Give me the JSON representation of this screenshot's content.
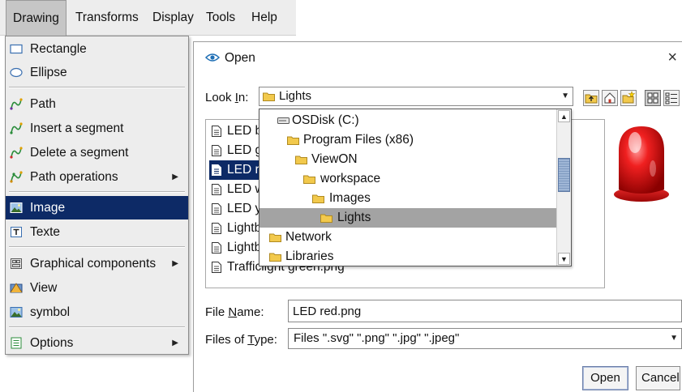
{
  "menubar": {
    "items": [
      {
        "label": "Drawing"
      },
      {
        "label": "Transforms"
      },
      {
        "label": "Display"
      },
      {
        "label": "Tools"
      },
      {
        "label": "Help"
      }
    ]
  },
  "drawing_menu": {
    "items": [
      {
        "label": "Rectangle",
        "icon": "rectangle-icon"
      },
      {
        "label": "Ellipse",
        "icon": "ellipse-icon"
      },
      {
        "label": "Path",
        "icon": "path-icon"
      },
      {
        "label": "Insert a segment",
        "icon": "insert-segment-icon"
      },
      {
        "label": "Delete a segment",
        "icon": "delete-segment-icon"
      },
      {
        "label": "Path operations",
        "icon": "path-operations-icon",
        "submenu": true
      },
      {
        "label": "Image",
        "icon": "image-icon",
        "selected": true
      },
      {
        "label": "Texte",
        "icon": "text-icon"
      },
      {
        "label": "Graphical components",
        "icon": "components-icon",
        "submenu": true
      },
      {
        "label": "View",
        "icon": "view-icon"
      },
      {
        "label": "symbol",
        "icon": "symbol-icon"
      },
      {
        "label": "Options",
        "icon": "options-icon",
        "submenu": true
      }
    ]
  },
  "dialog": {
    "title": "Open",
    "close_glyph": "×",
    "look_in": {
      "label_pre": "Look ",
      "label_mnemonic": "I",
      "label_post": "n:",
      "value": "Lights"
    },
    "lookin_options": [
      {
        "label": "OSDisk (C:)",
        "icon": "drive-icon"
      },
      {
        "label": "Program Files (x86)",
        "icon": "folder-icon"
      },
      {
        "label": "ViewON",
        "icon": "folder-icon"
      },
      {
        "label": "workspace",
        "icon": "folder-icon"
      },
      {
        "label": "Images",
        "icon": "folder-icon"
      },
      {
        "label": "Lights",
        "icon": "folder-icon",
        "selected": true
      },
      {
        "label": "Network",
        "icon": "folder-icon"
      },
      {
        "label": "Libraries",
        "icon": "folder-icon"
      }
    ],
    "files": [
      {
        "label": "LED b"
      },
      {
        "label": "LED g"
      },
      {
        "label": "LED re",
        "selected": true
      },
      {
        "label": "LED w"
      },
      {
        "label": "LED ye"
      },
      {
        "label": "Lightb"
      },
      {
        "label": "Lightb"
      },
      {
        "label": "Trafficlight green.png"
      }
    ],
    "file_name": {
      "label_pre": "File ",
      "label_mnemonic": "N",
      "label_post": "ame:",
      "value": "LED red.png"
    },
    "file_type": {
      "label_pre": "Files of ",
      "label_mnemonic": "T",
      "label_post": "ype:",
      "value": "Files \".svg\" \".png\" \".jpg\" \".jpeg\""
    },
    "open_label": "Open",
    "cancel_label": "Cancel"
  },
  "colors": {
    "selection": "#0d2a66",
    "menubar_bg": "#ededed",
    "folder": "#f2c94c",
    "led_red": "#e01515"
  }
}
